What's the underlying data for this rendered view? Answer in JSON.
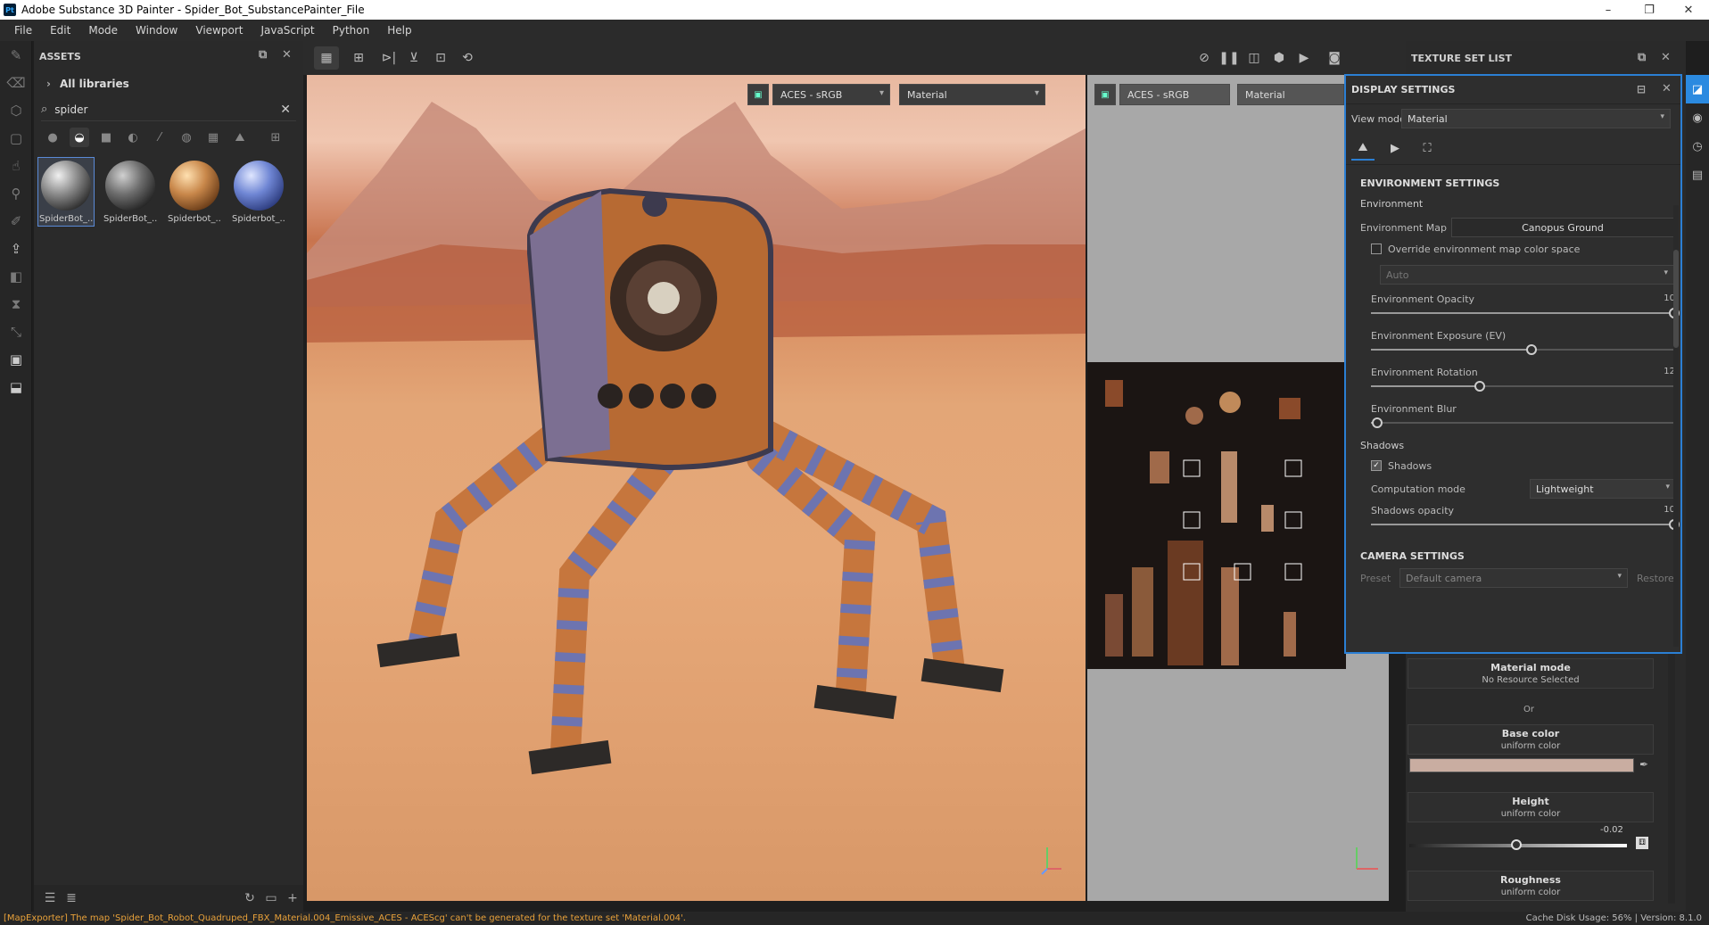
{
  "window": {
    "title": "Adobe Substance 3D Painter - Spider_Bot_SubstancePainter_File",
    "app_icon": "Pt",
    "controls": {
      "minimize": "–",
      "maximize": "❐",
      "close": "✕"
    }
  },
  "menu": [
    "File",
    "Edit",
    "Mode",
    "Window",
    "Viewport",
    "JavaScript",
    "Python",
    "Help"
  ],
  "assets": {
    "title": "ASSETS",
    "library": "All libraries",
    "search_value": "spider",
    "items": [
      {
        "label": "SpiderBot_...",
        "color": "#8a8a8a"
      },
      {
        "label": "SpiderBot_...",
        "color": "#6e6e6e"
      },
      {
        "label": "Spiderbot_...",
        "color": "#c8874a"
      },
      {
        "label": "Spiderbot_...",
        "color": "#6f86d4"
      }
    ]
  },
  "viewport3d": {
    "colorspace": "ACES - sRGB",
    "mode": "Material"
  },
  "viewport2d": {
    "colorspace": "ACES - sRGB",
    "mode": "Material"
  },
  "texture_set_list": {
    "title": "TEXTURE SET LIST"
  },
  "display_settings": {
    "title": "DISPLAY SETTINGS",
    "view_mode_label": "View mode",
    "view_mode_value": "Material",
    "environment_section": "ENVIRONMENT SETTINGS",
    "environment_sub": "Environment",
    "environment_map_label": "Environment Map",
    "environment_map_value": "Canopus Ground",
    "override_label": "Override environment map color space",
    "color_space_value": "Auto",
    "sliders": [
      {
        "label": "Environment Opacity",
        "value": "10",
        "fraction": 1.0
      },
      {
        "label": "Environment Exposure (EV)",
        "value": "",
        "fraction": 0.53
      },
      {
        "label": "Environment Rotation",
        "value": "12",
        "fraction": 0.36
      },
      {
        "label": "Environment Blur",
        "value": "",
        "fraction": 0.02
      }
    ],
    "shadows_sub": "Shadows",
    "shadows_check_label": "Shadows",
    "computation_label": "Computation mode",
    "computation_value": "Lightweight",
    "shadows_opacity": {
      "label": "Shadows opacity",
      "value": "10",
      "fraction": 1.0
    },
    "camera_section": "CAMERA SETTINGS",
    "preset_label": "Preset",
    "preset_value": "Default camera",
    "restore_label": "Restore"
  },
  "material_props": {
    "material_mode_title": "Material mode",
    "material_mode_sub": "No Resource Selected",
    "or_label": "Or",
    "base_color_title": "Base color",
    "base_color_sub": "uniform color",
    "base_color_swatch": "#c9ada1",
    "height_title": "Height",
    "height_sub": "uniform color",
    "height_value": "-0.02",
    "height_fraction": 0.49,
    "roughness_title": "Roughness",
    "roughness_sub": "uniform color"
  },
  "status": {
    "error": "[MapExporter] The map 'Spider_Bot_Robot_Quadruped_FBX_Material.004_Emissive_ACES - ACEScg' can't be generated for the texture set 'Material.004'.",
    "info": "Cache Disk Usage:   56% | Version: 8.1.0"
  }
}
